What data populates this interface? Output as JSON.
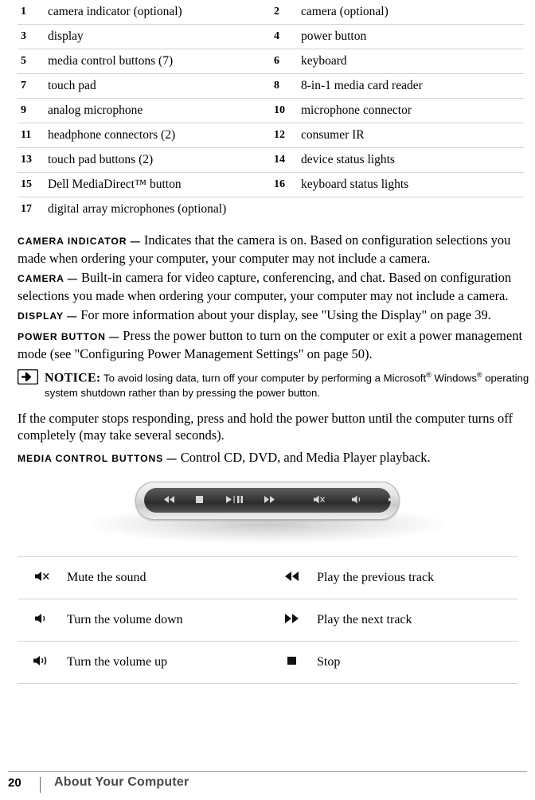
{
  "legend": {
    "rows": [
      {
        "n1": "1",
        "t1": "camera indicator (optional)",
        "n2": "2",
        "t2": "camera (optional)"
      },
      {
        "n1": "3",
        "t1": "display",
        "n2": "4",
        "t2": "power button"
      },
      {
        "n1": "5",
        "t1": "media control buttons (7)",
        "n2": "6",
        "t2": "keyboard"
      },
      {
        "n1": "7",
        "t1": "touch pad",
        "n2": "8",
        "t2": "8-in-1 media card reader"
      },
      {
        "n1": "9",
        "t1": "analog microphone",
        "n2": "10",
        "t2": "microphone connector"
      },
      {
        "n1": "11",
        "t1": "headphone connectors (2)",
        "n2": "12",
        "t2": "consumer IR"
      },
      {
        "n1": "13",
        "t1": "touch pad buttons (2)",
        "n2": "14",
        "t2": "device status lights"
      },
      {
        "n1": "15",
        "t1": "Dell MediaDirect™ button",
        "n2": "16",
        "t2": "keyboard status lights"
      },
      {
        "n1": "17",
        "t1": "digital array microphones (optional)",
        "n2": "",
        "t2": ""
      }
    ]
  },
  "definitions": [
    {
      "term": "CAMERA INDICATOR —",
      "text": "Indicates that the camera is on. Based on configuration selections you made when ordering your computer, your computer may not include a camera."
    },
    {
      "term": "CAMERA —",
      "text": "Built-in camera for video capture, conferencing, and chat. Based on configuration selections you made when ordering your computer, your computer may not include a camera."
    },
    {
      "term": "DISPLAY —",
      "text": "For more information about your display, see \"Using the Display\" on page 39."
    },
    {
      "term": "POWER BUTTON —",
      "text": "Press the power button to turn on the computer or exit a power management mode (see \"Configuring Power Management Settings\" on page 50)."
    }
  ],
  "notice": {
    "label": "NOTICE:",
    "text_part1": "To avoid losing data, turn off your computer by performing a Microsoft",
    "text_part2": "Windows",
    "text_part3": " operating system shutdown rather than by pressing the power button.",
    "reg_mark": "®",
    "icon_name": "notice-arrow-icon"
  },
  "after_notice": {
    "text": "If the computer stops responding, press and hold the power button until the computer turns off completely (may take several seconds)."
  },
  "media_def": {
    "term": "MEDIA CONTROL BUTTONS —",
    "text": "Control CD, DVD, and Media Player playback."
  },
  "figure": {
    "name": "media-control-panel-image",
    "controls": [
      {
        "name": "previous-track-icon",
        "glyph": "◀◀"
      },
      {
        "name": "stop-icon",
        "glyph": "■"
      },
      {
        "name": "play-pause-icon",
        "glyph": "▶/❙❙"
      },
      {
        "name": "next-track-icon",
        "glyph": "▶▶"
      },
      {
        "name": "mute-icon",
        "glyph": "🔇"
      },
      {
        "name": "volume-down-icon",
        "glyph": "🔉"
      },
      {
        "name": "volume-up-icon",
        "glyph": "🔊"
      }
    ]
  },
  "control_table": {
    "rows": [
      {
        "icon1": "mute-icon",
        "label1": "Mute the sound",
        "icon2": "previous-track-icon",
        "label2": "Play the previous track"
      },
      {
        "icon1": "volume-down-icon",
        "label1": "Turn the volume down",
        "icon2": "next-track-icon",
        "label2": "Play the next track"
      },
      {
        "icon1": "volume-up-icon",
        "label1": "Turn the volume up",
        "icon2": "stop-icon",
        "label2": "Stop"
      }
    ]
  },
  "footer": {
    "page_number": "20",
    "chapter_title": "About Your Computer"
  }
}
